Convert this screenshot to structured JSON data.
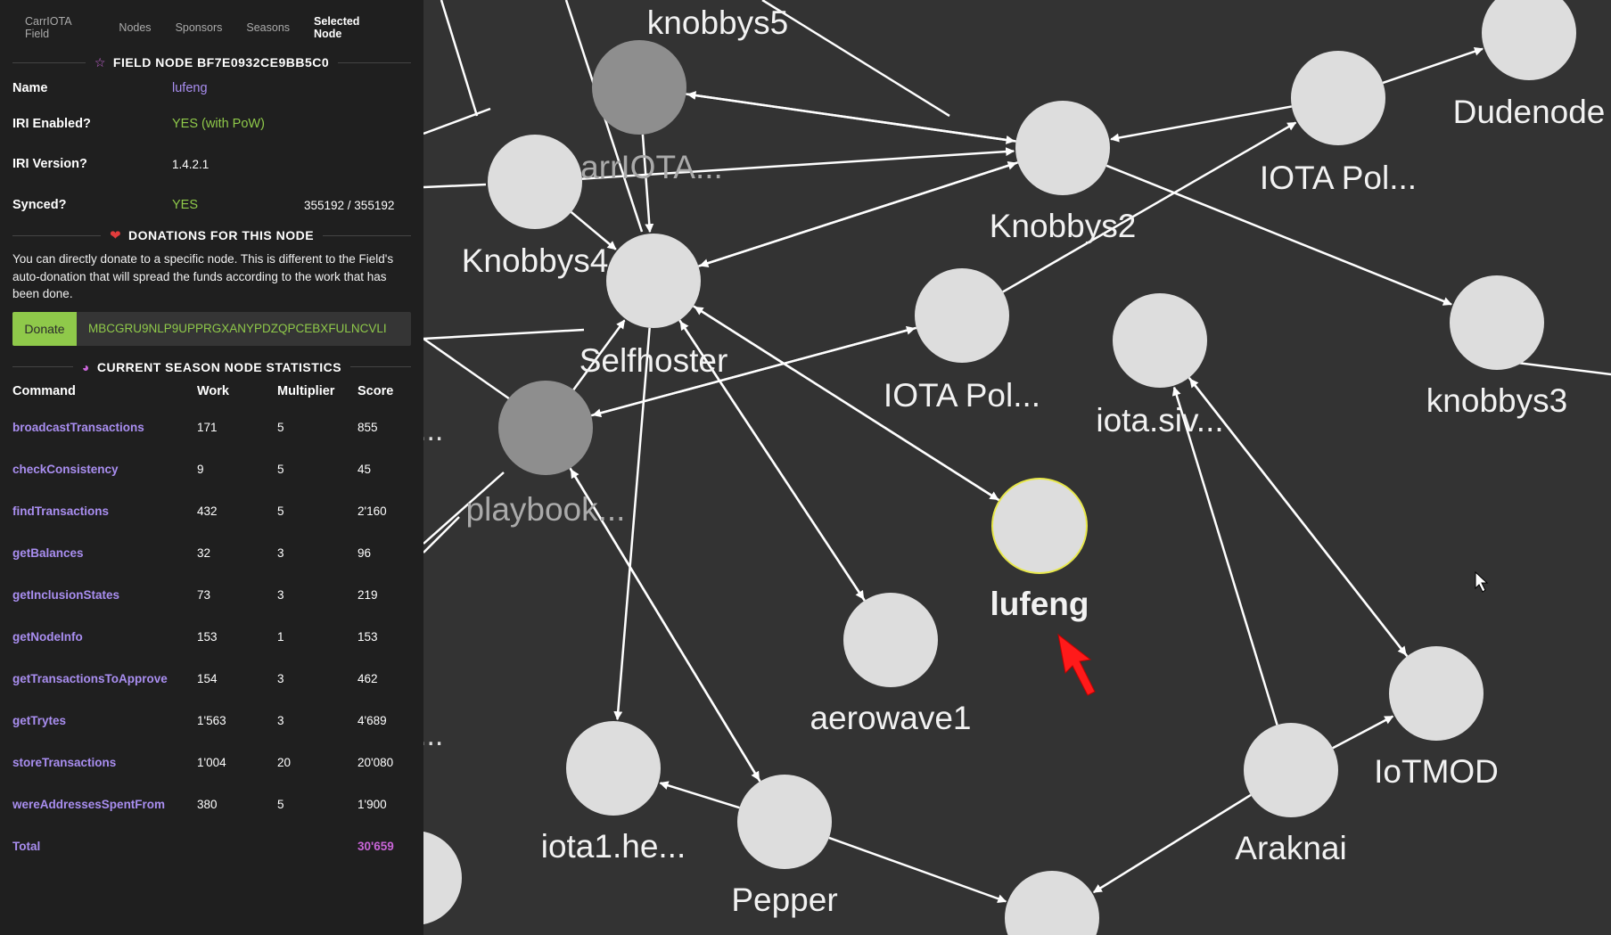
{
  "tabs": [
    "CarrIOTA Field",
    "Nodes",
    "Sponsors",
    "Seasons",
    "Selected Node"
  ],
  "field_node": {
    "title": "FIELD NODE BF7E0932CE9BB5C0",
    "name_label": "Name",
    "name_value": "lufeng",
    "iri_enabled_label": "IRI Enabled?",
    "iri_enabled_value": "YES (with PoW)",
    "iri_version_label": "IRI Version?",
    "iri_version_value": "1.4.2.1",
    "synced_label": "Synced?",
    "synced_value": "YES",
    "synced_milestones": "355192 / 355192"
  },
  "donations": {
    "title": "DONATIONS FOR THIS NODE",
    "description": "You can directly donate to a specific node. This is different to the Field's auto-donation that will spread the funds according to the work that has been done.",
    "button_label": "Donate",
    "address": "MBCGRU9NLP9UPPRGXANYPDZQPCEBXFULNCVLI"
  },
  "stats": {
    "title": "CURRENT SEASON NODE STATISTICS",
    "headers": [
      "Command",
      "Work",
      "Multiplier",
      "Score"
    ],
    "rows": [
      [
        "broadcastTransactions",
        "171",
        "5",
        "855"
      ],
      [
        "checkConsistency",
        "9",
        "5",
        "45"
      ],
      [
        "findTransactions",
        "432",
        "5",
        "2'160"
      ],
      [
        "getBalances",
        "32",
        "3",
        "96"
      ],
      [
        "getInclusionStates",
        "73",
        "3",
        "219"
      ],
      [
        "getNodeInfo",
        "153",
        "1",
        "153"
      ],
      [
        "getTransactionsToApprove",
        "154",
        "3",
        "462"
      ],
      [
        "getTrytes",
        "1'563",
        "3",
        "4'689"
      ],
      [
        "storeTransactions",
        "1'004",
        "20",
        "20'080"
      ],
      [
        "wereAddressesSpentFrom",
        "380",
        "5",
        "1'900"
      ]
    ],
    "total_label": "Total",
    "total_score": "30'659"
  },
  "graph": {
    "nodes": [
      {
        "id": "knobbys5",
        "label": "knobbys5",
        "shade": "normal"
      },
      {
        "id": "carriota",
        "label": "arrIOTA...",
        "shade": "dark"
      },
      {
        "id": "knobbys4",
        "label": "Knobbys4",
        "shade": "normal"
      },
      {
        "id": "selfhoster",
        "label": "Selfhoster",
        "shade": "normal"
      },
      {
        "id": "playbook",
        "label": "playbook...",
        "shade": "dark"
      },
      {
        "id": "knobbys2",
        "label": "Knobbys2",
        "shade": "normal"
      },
      {
        "id": "iotapol1",
        "label": "IOTA Pol...",
        "shade": "normal"
      },
      {
        "id": "dudenode",
        "label": "Dudenode",
        "shade": "normal"
      },
      {
        "id": "iotapol2",
        "label": "IOTA Pol...",
        "shade": "normal"
      },
      {
        "id": "iotasiv",
        "label": "iota.siv...",
        "shade": "normal"
      },
      {
        "id": "knobbys3",
        "label": "knobbys3",
        "shade": "normal"
      },
      {
        "id": "lufeng",
        "label": "lufeng",
        "shade": "selected"
      },
      {
        "id": "aerowave1",
        "label": "aerowave1",
        "shade": "normal"
      },
      {
        "id": "iotmod",
        "label": "IoTMOD",
        "shade": "normal"
      },
      {
        "id": "iota1he",
        "label": "iota1.he...",
        "shade": "normal"
      },
      {
        "id": "pepper",
        "label": "Pepper",
        "shade": "normal"
      },
      {
        "id": "araknai",
        "label": "Araknai",
        "shade": "normal"
      },
      {
        "id": "bottom",
        "label": "",
        "shade": "normal"
      },
      {
        "id": "bottomleft",
        "label": "",
        "shade": "normal"
      }
    ],
    "edge_stub_labels": [
      "...",
      "..."
    ],
    "colors": {
      "background": "#333333",
      "node": "#dddddd",
      "node_dark": "#8e8e8e",
      "selected_border": "#e8e84a",
      "edge": "#ffffff",
      "pointer": "#ff1a1a"
    }
  }
}
